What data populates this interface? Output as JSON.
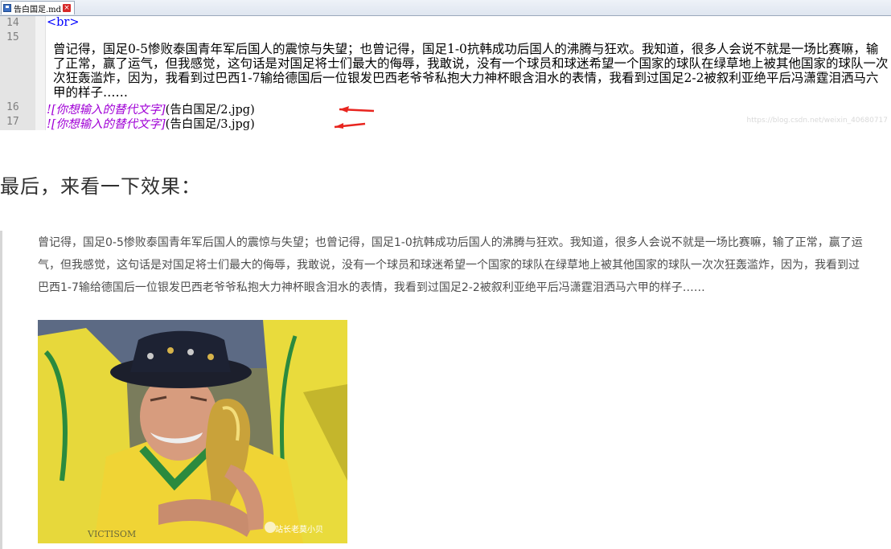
{
  "editor": {
    "tab_name": "告白国足.md",
    "lines": [
      {
        "num": "14",
        "text": "<br>"
      },
      {
        "num": "15",
        "text": "曾记得，国足0-5惨败泰国青年军后国人的震惊与失望；也曾记得，国足1-0抗韩成功后国人的沸腾与狂欢。我知道，很多人会说不就是一场比赛嘛，输了正常，赢了运气，但我感觉，这句话是对国足将士们最大的侮辱，我敢说，没有一个球员和球迷希望一个国家的球队在绿草地上被其他国家的球队一次次狂轰滥炸，因为，我看到过巴西1-7输给德国后一位银发巴西老爷爷私抱大力神杯眼含泪水的表情，我看到过国足2-2被叙利亚绝平后冯潇霆泪洒马六甲的样子……"
      },
      {
        "num": "16",
        "prefix": "![",
        "alt": "你想输入的替代文字",
        "suffix": "](告白国足/2.jpg)"
      },
      {
        "num": "17",
        "prefix": "![",
        "alt": "你想输入的替代文字",
        "suffix": "](告白国足/3.jpg)"
      }
    ],
    "watermark": "https://blog.csdn.net/weixin_40680717"
  },
  "heading": "最后，来看一下效果：",
  "preview": {
    "paragraph": "曾记得，国足0-5惨败泰国青年军后国人的震惊与失望；也曾记得，国足1-0抗韩成功后国人的沸腾与狂欢。我知道，很多人会说不就是一场比赛嘛，输了正常，赢了运气，但我感觉，这句话是对国足将士们最大的侮辱，我敢说，没有一个球员和球迷希望一个国家的球队在绿草地上被其他国家的球队一次次狂轰滥炸，因为，我看到过巴西1-7输给德国后一位银发巴西老爷爷私抱大力神杯眼含泪水的表情，我看到过国足2-2被叙利亚绝平后冯潇霆泪洒马六甲的样子……",
    "photo_credit": "站长老莫小贝",
    "photo_shirt_text": "VICTISOM"
  },
  "colors": {
    "arrow": "#e8251f",
    "alt_text": "#a000d6",
    "tag": "#0000ff"
  }
}
